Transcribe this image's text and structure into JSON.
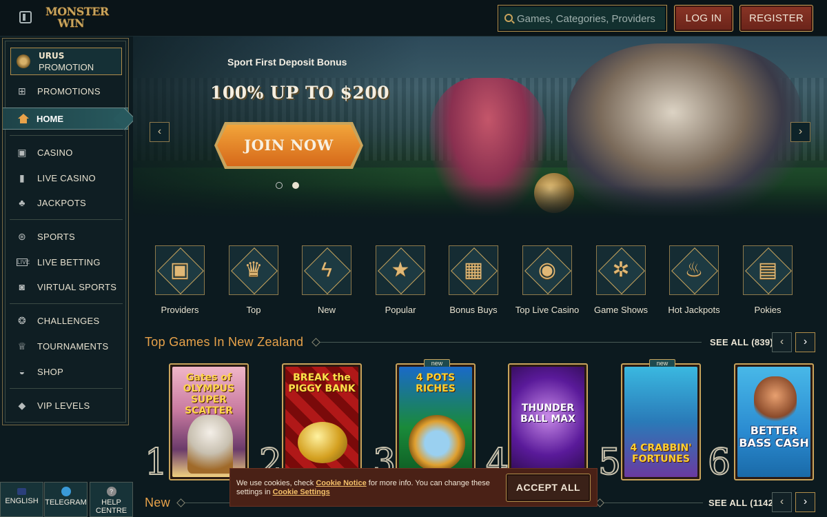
{
  "header": {
    "brand_line1": "MONSTER",
    "brand_line2": "WIN",
    "search_placeholder": "Games, Categories, Providers",
    "login_label": "LOG IN",
    "register_label": "REGISTER"
  },
  "sidebar": {
    "urus_title": "URUS",
    "urus_subtitle": "PROMOTION",
    "items": [
      {
        "label": "PROMOTIONS",
        "icon": "gift-icon"
      },
      {
        "label": "HOME",
        "icon": "home-icon"
      },
      {
        "label": "CASINO",
        "icon": "slot-machine-icon"
      },
      {
        "label": "LIVE CASINO",
        "icon": "cards-icon"
      },
      {
        "label": "JACKPOTS",
        "icon": "clover-icon"
      },
      {
        "label": "SPORTS",
        "icon": "ball-icon"
      },
      {
        "label": "LIVE BETTING",
        "icon": "live-icon"
      },
      {
        "label": "VIRTUAL SPORTS",
        "icon": "virtual-icon"
      },
      {
        "label": "CHALLENGES",
        "icon": "challenge-icon"
      },
      {
        "label": "TOURNAMENTS",
        "icon": "trophy-icon"
      },
      {
        "label": "SHOP",
        "icon": "basket-icon"
      },
      {
        "label": "VIP LEVELS",
        "icon": "diamond-icon"
      }
    ],
    "bottom": {
      "language": "ENGLISH",
      "telegram": "TELEGRAM",
      "help_line1": "HELP",
      "help_line2": "CENTRE"
    }
  },
  "hero": {
    "subtitle": "Sport First Deposit Bonus",
    "title": "100% UP TO $200",
    "cta": "JOIN NOW",
    "prev": "‹",
    "next": "›"
  },
  "categories": [
    {
      "label": "Providers",
      "icon": "book-icon",
      "glyph": "▣"
    },
    {
      "label": "Top",
      "icon": "crown-icon",
      "glyph": "♛"
    },
    {
      "label": "New",
      "icon": "lightning-icon",
      "glyph": "ϟ"
    },
    {
      "label": "Popular",
      "icon": "star-icon",
      "glyph": "★"
    },
    {
      "label": "Bonus Buys",
      "icon": "chest-icon",
      "glyph": "▦"
    },
    {
      "label": "Top Live Casino",
      "icon": "chip-icon",
      "glyph": "◉"
    },
    {
      "label": "Game Shows",
      "icon": "wheel-icon",
      "glyph": "✲"
    },
    {
      "label": "Hot Jackpots",
      "icon": "flame-icon",
      "glyph": "♨"
    },
    {
      "label": "Pokies",
      "icon": "slot-icon",
      "glyph": "▤"
    }
  ],
  "top_games": {
    "title": "Top Games In New Zealand",
    "see_all": "SEE ALL (839)",
    "games": [
      {
        "rank": "1",
        "name": "Gates of OLYMPUS SUPER SCATTER",
        "badge": ""
      },
      {
        "rank": "2",
        "name": "BREAK the PIGGY BANK",
        "badge": ""
      },
      {
        "rank": "3",
        "name": "4 POTS RICHES",
        "badge": "new"
      },
      {
        "rank": "4",
        "name": "THUNDER BALL MAX",
        "badge": ""
      },
      {
        "rank": "5",
        "name": "4 CRABBIN' FORTUNES",
        "badge": "new"
      },
      {
        "rank": "6",
        "name": "BETTER BASS CASH",
        "badge": ""
      }
    ]
  },
  "new_section": {
    "title": "New",
    "see_all": "SEE ALL (1142)"
  },
  "cookie": {
    "text_pre": "We use cookies, check ",
    "notice_link": "Cookie Notice",
    "text_mid": " for more info. You can change these settings in ",
    "settings_link": "Cookie Settings",
    "accept": "ACCEPT ALL"
  },
  "colors": {
    "accent_gold": "#c9a45c",
    "section_orange": "#e8a24a",
    "cta_orange": "#e38627",
    "button_red": "#7a2c20"
  }
}
